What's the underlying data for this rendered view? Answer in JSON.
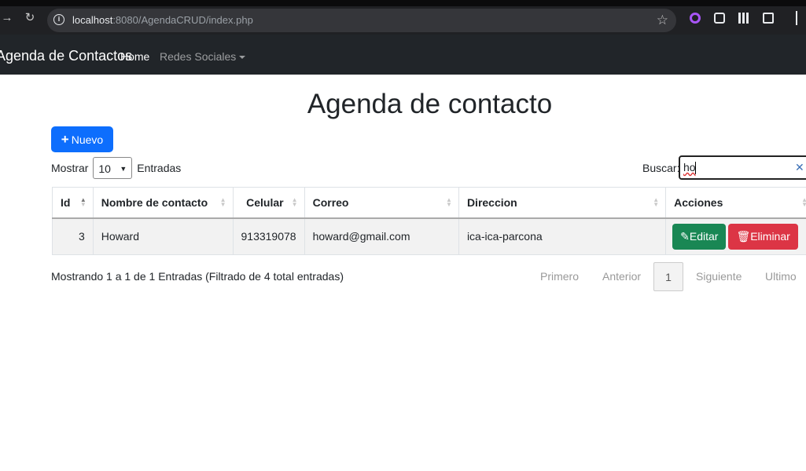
{
  "browser": {
    "url_host": "localhost",
    "url_rest": ":8080/AgendaCRUD/index.php"
  },
  "navbar": {
    "brand": "Agenda de Contactos",
    "home": "Home",
    "redes": "Redes Sociales"
  },
  "page": {
    "title": "Agenda de contacto",
    "new_button": "Nuevo"
  },
  "length": {
    "prefix": "Mostrar",
    "value": "10",
    "suffix": "Entradas"
  },
  "search": {
    "label": "Buscar:",
    "value": "ho"
  },
  "table": {
    "headers": [
      "Id",
      "Nombre de contacto",
      "Celular",
      "Correo",
      "Direccion",
      "Acciones"
    ],
    "rows": [
      {
        "id": "3",
        "nombre": "Howard",
        "celular": "913319078",
        "correo": "howard@gmail.com",
        "direccion": "ica-ica-parcona",
        "edit_label": "Editar",
        "delete_label": "Eliminar"
      }
    ]
  },
  "footer": {
    "info": "Mostrando 1 a 1 de 1 Entradas (Filtrado de 4 total entradas)",
    "first": "Primero",
    "prev": "Anterior",
    "current": "1",
    "next": "Siguiente",
    "last": "Ultimo"
  },
  "colors": {
    "primary": "#0d6efd",
    "success": "#198754",
    "danger": "#dc3545",
    "navbar": "#212529"
  }
}
